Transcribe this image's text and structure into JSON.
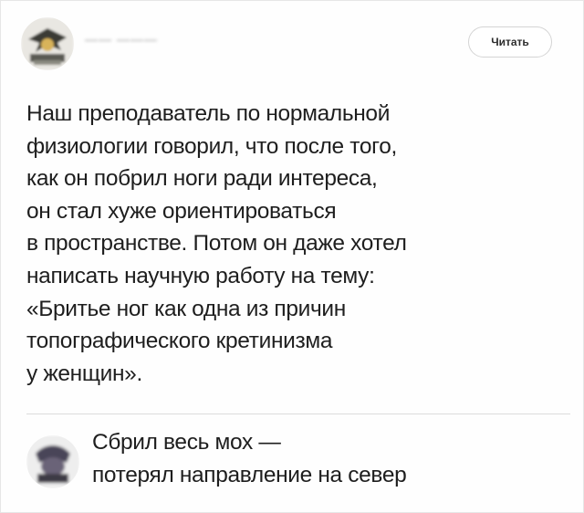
{
  "post": {
    "author_name": "—— ———",
    "follow_label": "Читать",
    "lines": [
      "Наш преподаватель по нормальной",
      "физиологии говорил, что после того,",
      "как он побрил ноги ради интереса,",
      "он стал хуже ориентироваться",
      "в пространстве. Потом он даже хотел",
      "написать научную работу на тему:",
      "«Бритье ног как одна из причин",
      "топографического кретинизма",
      "у женщин»."
    ]
  },
  "reply": {
    "lines": [
      "Сбрил весь мох —",
      "потерял направление на север"
    ]
  },
  "colors": {
    "text": "#1e1e1e",
    "divider": "#dcdcdc",
    "button_border": "#d4d4d4"
  },
  "icons": {
    "author_avatar": "avatar-icon",
    "reply_avatar": "avatar-icon"
  }
}
